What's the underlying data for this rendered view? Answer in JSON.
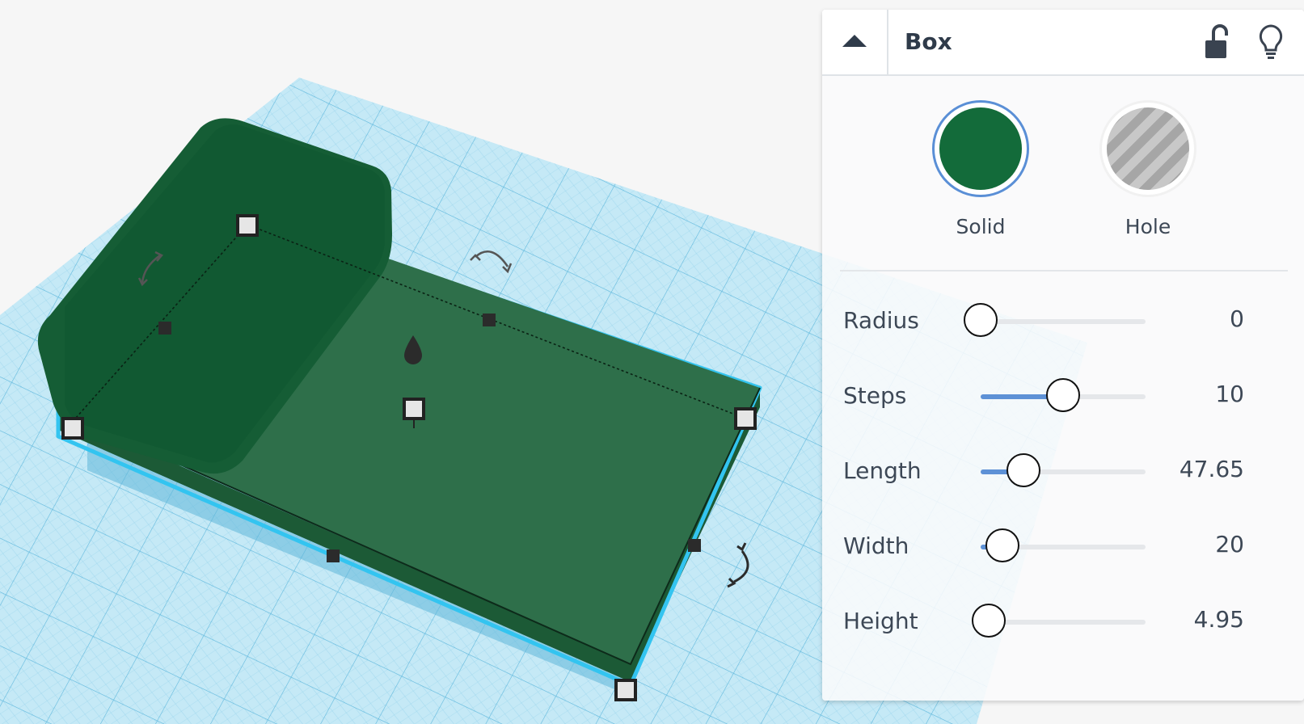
{
  "inspector": {
    "title": "Box",
    "collapse_icon": "caret-up-icon",
    "lock_icon": "unlock-icon",
    "bulb_icon": "lightbulb-icon",
    "colors": {
      "solid": {
        "label": "Solid",
        "color": "#136b3a",
        "selected": true
      },
      "hole": {
        "label": "Hole",
        "pattern": "gray-stripes"
      }
    },
    "params": [
      {
        "label": "Radius",
        "value": "0",
        "level": 0.0
      },
      {
        "label": "Steps",
        "value": "10",
        "level": 0.5
      },
      {
        "label": "Length",
        "value": "47.65",
        "level": 0.26
      },
      {
        "label": "Width",
        "value": "20",
        "level": 0.13
      },
      {
        "label": "Height",
        "value": "4.95",
        "level": 0.05
      }
    ]
  },
  "scene": {
    "workplane_color": "#b8e3f3",
    "grid_color": "#7cc6e4",
    "shape_color": "#136b3a"
  }
}
